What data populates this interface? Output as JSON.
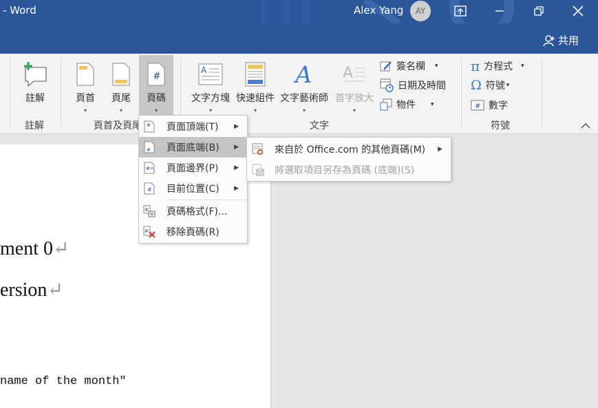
{
  "titlebar": {
    "title": "- Word",
    "user_name": "Alex Yang",
    "avatar_initials": "AY",
    "share_label": "共用"
  },
  "ribbon": {
    "comment": {
      "label": "註解",
      "group": "註解"
    },
    "header": {
      "label": "頁首"
    },
    "footer": {
      "label": "頁尾"
    },
    "page_number": {
      "label": "頁碼"
    },
    "header_footer_group": "頁首及頁尾",
    "text_box": {
      "label": "文字方塊"
    },
    "quick_parts": {
      "label": "快速組件"
    },
    "wordart": {
      "label": "文字藝術師"
    },
    "drop_cap": {
      "label": "首字放大"
    },
    "signature_line": {
      "label": "簽名欄"
    },
    "date_time": {
      "label": "日期及時間"
    },
    "object": {
      "label": "物件"
    },
    "text_group": "文字",
    "equation": {
      "label": "方程式"
    },
    "symbol": {
      "label": "符號"
    },
    "number": {
      "label": "數字"
    },
    "symbols_group": "符號"
  },
  "page_number_menu": {
    "items": [
      {
        "label": "頁面頂端(T)",
        "has_submenu": true
      },
      {
        "label": "頁面底端(B)",
        "has_submenu": true,
        "highlighted": true
      },
      {
        "label": "頁面邊界(P)",
        "has_submenu": true
      },
      {
        "label": "目前位置(C)",
        "has_submenu": true
      },
      {
        "label": "頁碼格式(F)..."
      },
      {
        "label": "移除頁碼(R)"
      }
    ]
  },
  "bottom_submenu": {
    "items": [
      {
        "label": "來自於 Office.com 的其他頁碼(M)",
        "has_submenu": true
      },
      {
        "label": "將選取項目另存為頁碼 (底端)(S)",
        "disabled": true
      }
    ]
  },
  "document": {
    "line1": "ment 0",
    "line2": "ersion",
    "line3": "name of the month\"",
    "paragraph_mark": "↵"
  },
  "colors": {
    "titlebar_bg": "#2b579a",
    "ribbon_bg": "#f3f3f3",
    "menu_highlight": "#c5c5c5"
  }
}
